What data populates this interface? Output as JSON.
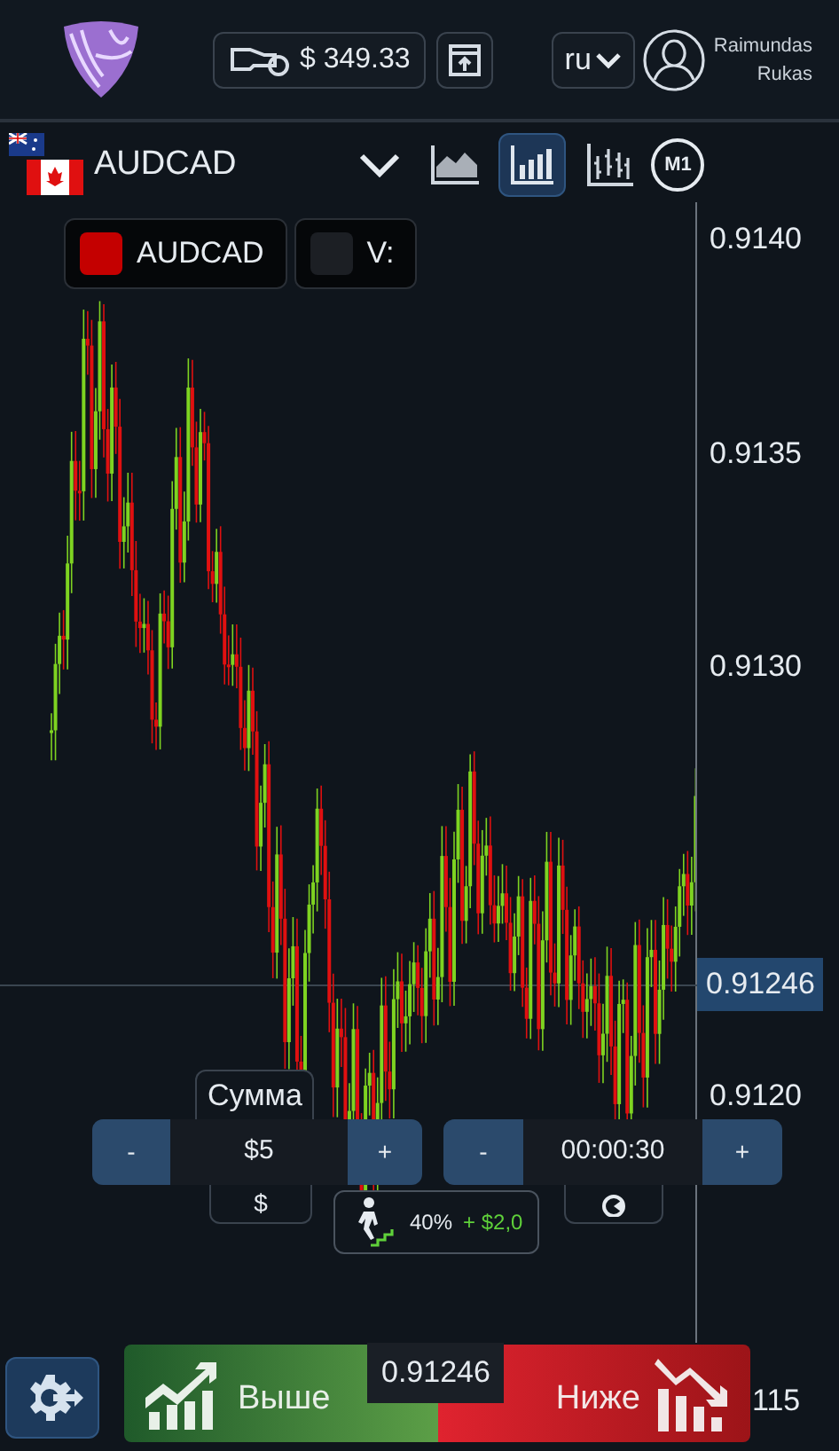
{
  "header": {
    "balance": "$ 349.33",
    "language": "ru",
    "user_name": [
      "Raimundas",
      "Rukas"
    ]
  },
  "chart_toolbar": {
    "pair": "AUDCAD",
    "chart_types": [
      {
        "kind": "area",
        "selected": false
      },
      {
        "kind": "candles",
        "selected": true
      },
      {
        "kind": "bars",
        "selected": false
      }
    ],
    "timeframe": "M1"
  },
  "legend": [
    {
      "label": "AUDCAD",
      "color": "#c40000"
    },
    {
      "label": "V:",
      "color": "#1c1f24"
    }
  ],
  "price_axis": {
    "ticks": [
      "0.9140",
      "0.9135",
      "0.9130",
      "0.9120"
    ],
    "current_price": "0.91246",
    "edge_label": "115"
  },
  "trade": {
    "amount_label": "Сумма",
    "amount": "$5",
    "currency": "$",
    "duration": "00:00:30",
    "minus": "-",
    "plus": "+",
    "payout": "40%",
    "profit": "+ $2,0",
    "up": "Выше",
    "down": "Ниже",
    "price": "0.91246"
  }
}
